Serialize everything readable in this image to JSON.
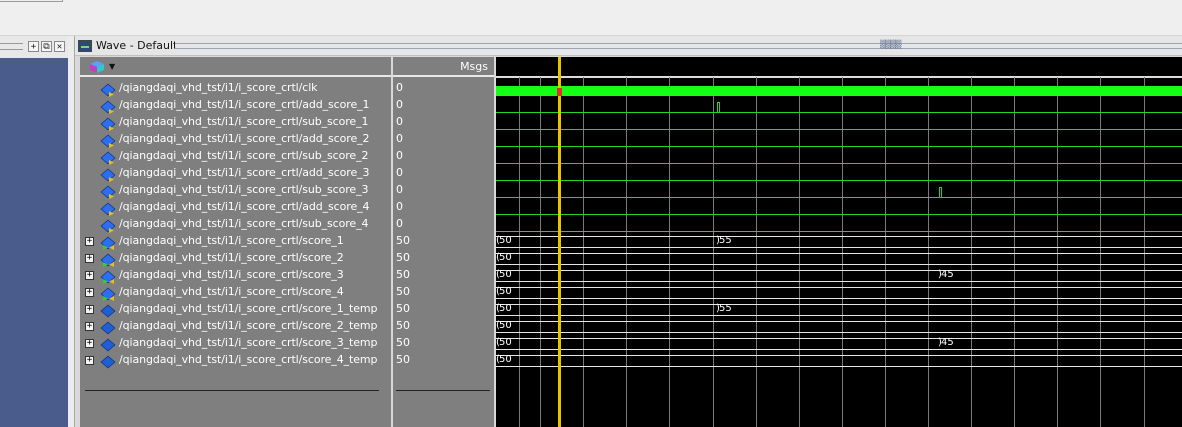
{
  "window": {
    "title": "Wave - Default",
    "icon": "wave-window-icon",
    "toolbar_buttons": [
      "dock-icon",
      "maximize-icon",
      "close-icon"
    ],
    "toolbar_labels": [
      "+",
      "⧉",
      "✕"
    ]
  },
  "columns": {
    "messages_header": "Msgs"
  },
  "signals": [
    {
      "name": "/qiangdaqi_vhd_tst/i1/i_score_crtl/clk",
      "value": "0",
      "expandable": false,
      "icon": "signal-in-icon"
    },
    {
      "name": "/qiangdaqi_vhd_tst/i1/i_score_crtl/add_score_1",
      "value": "0",
      "expandable": false,
      "icon": "signal-in-icon"
    },
    {
      "name": "/qiangdaqi_vhd_tst/i1/i_score_crtl/sub_score_1",
      "value": "0",
      "expandable": false,
      "icon": "signal-in-icon"
    },
    {
      "name": "/qiangdaqi_vhd_tst/i1/i_score_crtl/add_score_2",
      "value": "0",
      "expandable": false,
      "icon": "signal-in-icon"
    },
    {
      "name": "/qiangdaqi_vhd_tst/i1/i_score_crtl/sub_score_2",
      "value": "0",
      "expandable": false,
      "icon": "signal-in-icon"
    },
    {
      "name": "/qiangdaqi_vhd_tst/i1/i_score_crtl/add_score_3",
      "value": "0",
      "expandable": false,
      "icon": "signal-in-icon"
    },
    {
      "name": "/qiangdaqi_vhd_tst/i1/i_score_crtl/sub_score_3",
      "value": "0",
      "expandable": false,
      "icon": "signal-in-icon"
    },
    {
      "name": "/qiangdaqi_vhd_tst/i1/i_score_crtl/add_score_4",
      "value": "0",
      "expandable": false,
      "icon": "signal-in-icon"
    },
    {
      "name": "/qiangdaqi_vhd_tst/i1/i_score_crtl/sub_score_4",
      "value": "0",
      "expandable": false,
      "icon": "signal-in-icon"
    },
    {
      "name": "/qiangdaqi_vhd_tst/i1/i_score_crtl/score_1",
      "value": "50",
      "expandable": true,
      "icon": "signal-inout-icon"
    },
    {
      "name": "/qiangdaqi_vhd_tst/i1/i_score_crtl/score_2",
      "value": "50",
      "expandable": true,
      "icon": "signal-inout-icon"
    },
    {
      "name": "/qiangdaqi_vhd_tst/i1/i_score_crtl/score_3",
      "value": "50",
      "expandable": true,
      "icon": "signal-inout-icon"
    },
    {
      "name": "/qiangdaqi_vhd_tst/i1/i_score_crtl/score_4",
      "value": "50",
      "expandable": true,
      "icon": "signal-inout-icon"
    },
    {
      "name": "/qiangdaqi_vhd_tst/i1/i_score_crtl/score_1_temp",
      "value": "50",
      "expandable": true,
      "icon": "signal-internal-icon"
    },
    {
      "name": "/qiangdaqi_vhd_tst/i1/i_score_crtl/score_2_temp",
      "value": "50",
      "expandable": true,
      "icon": "signal-internal-icon"
    },
    {
      "name": "/qiangdaqi_vhd_tst/i1/i_score_crtl/score_3_temp",
      "value": "50",
      "expandable": true,
      "icon": "signal-internal-icon"
    },
    {
      "name": "/qiangdaqi_vhd_tst/i1/i_score_crtl/score_4_temp",
      "value": "50",
      "expandable": true,
      "icon": "signal-internal-icon"
    }
  ],
  "waves": [
    {
      "kind": "clock"
    },
    {
      "kind": "bit",
      "pulse_at": 0.322
    },
    {
      "kind": "bit"
    },
    {
      "kind": "bit"
    },
    {
      "kind": "bit"
    },
    {
      "kind": "bit"
    },
    {
      "kind": "bit",
      "pulse_at": 0.645
    },
    {
      "kind": "bit"
    },
    {
      "kind": "bit"
    },
    {
      "kind": "bus",
      "segments": [
        {
          "label": "50"
        },
        {
          "label": "55",
          "start": 0.322
        }
      ]
    },
    {
      "kind": "bus",
      "segments": [
        {
          "label": "50"
        }
      ]
    },
    {
      "kind": "bus",
      "segments": [
        {
          "label": "50"
        },
        {
          "label": "45",
          "start": 0.645
        }
      ]
    },
    {
      "kind": "bus",
      "segments": [
        {
          "label": "50"
        }
      ]
    },
    {
      "kind": "bus",
      "segments": [
        {
          "label": "50"
        },
        {
          "label": "55",
          "start": 0.322
        }
      ]
    },
    {
      "kind": "bus",
      "segments": [
        {
          "label": "50"
        }
      ]
    },
    {
      "kind": "bus",
      "segments": [
        {
          "label": "50"
        },
        {
          "label": "45",
          "start": 0.645
        }
      ]
    },
    {
      "kind": "bus",
      "segments": [
        {
          "label": "50"
        }
      ]
    }
  ],
  "cursor": {
    "color": "#e8c400"
  },
  "colors": {
    "wave_green": "#22d822",
    "clock_green": "#14ff14",
    "panel_gray": "#7f7f7f",
    "left_blue": "#4a5c8c"
  }
}
